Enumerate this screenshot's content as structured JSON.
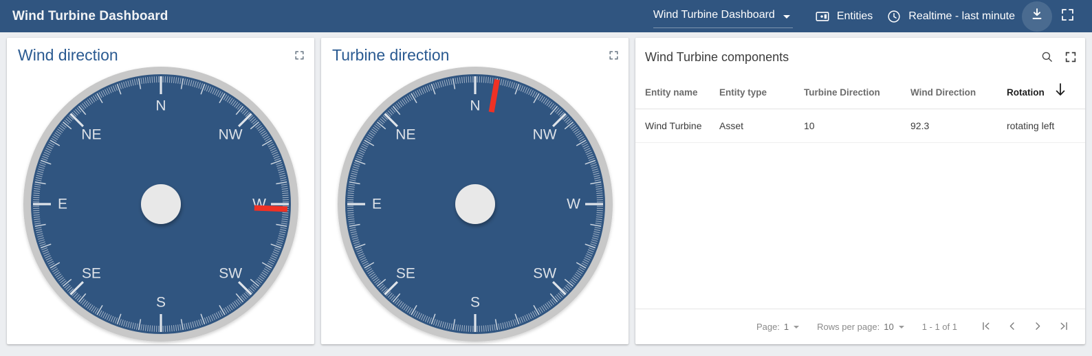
{
  "topbar": {
    "title": "Wind Turbine Dashboard",
    "dashboard_select": {
      "value": "Wind Turbine Dashboard",
      "icon": "chevron-down-icon"
    },
    "entities": {
      "label": "Entities",
      "icon": "entities-icon"
    },
    "timewindow": {
      "label": "Realtime - last minute",
      "icon": "clock-icon"
    },
    "download": {
      "icon": "download-icon"
    },
    "fullscreen": {
      "icon": "fullscreen-icon"
    },
    "bg_color": "#305580"
  },
  "cards": {
    "wind": {
      "title": "Wind direction",
      "expand_icon": "expand-icon",
      "compass": {
        "labels": [
          "N",
          "NW",
          "W",
          "SW",
          "S",
          "SE",
          "E",
          "NE"
        ],
        "needle_angle_deg": 92.3,
        "needle_color": "#ef3124",
        "face_color": "#305580",
        "rim_color": "#c8c8c8",
        "hub_color": "#e8e8e8",
        "tick_color": "#dfe4ea"
      }
    },
    "turbine": {
      "title": "Turbine direction",
      "expand_icon": "expand-icon",
      "compass": {
        "labels": [
          "N",
          "NW",
          "W",
          "SW",
          "S",
          "SE",
          "E",
          "NE"
        ],
        "needle_angle_deg": 10,
        "needle_color": "#ef3124",
        "face_color": "#305580",
        "rim_color": "#c8c8c8",
        "hub_color": "#e8e8e8",
        "tick_color": "#dfe4ea"
      }
    },
    "table": {
      "title": "Wind Turbine components",
      "search_icon": "search-icon",
      "fullscreen_icon": "fullscreen-icon",
      "columns": [
        {
          "label": "Entity name",
          "sorted": false
        },
        {
          "label": "Entity type",
          "sorted": false
        },
        {
          "label": "Turbine Direction",
          "sorted": false
        },
        {
          "label": "Wind Direction",
          "sorted": false
        },
        {
          "label": "Rotation",
          "sorted": true,
          "sort_icon": "arrow-down-icon"
        }
      ],
      "rows": [
        {
          "entity_name": "Wind Turbine",
          "entity_type": "Asset",
          "turbine_direction": "10",
          "wind_direction": "92.3",
          "rotation": "rotating left"
        }
      ],
      "footer": {
        "page_label": "Page:",
        "page_value": "1",
        "rows_per_page_label": "Rows per page:",
        "rows_per_page_value": "10",
        "range": "1 - 1 of 1",
        "first_icon": "first-page-icon",
        "prev_icon": "chevron-left-icon",
        "next_icon": "chevron-right-icon",
        "last_icon": "last-page-icon"
      }
    }
  }
}
